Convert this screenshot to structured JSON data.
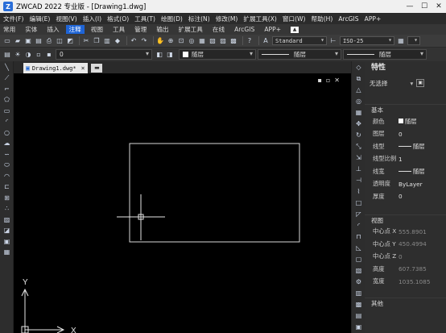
{
  "titlebar": {
    "app_icon": "Z",
    "title": "ZWCAD 2022 专业版 - [Drawing1.dwg]",
    "minimize": "—",
    "maximize": "☐",
    "close": "✕"
  },
  "menu": [
    "文件(F)",
    "编辑(E)",
    "视图(V)",
    "插入(I)",
    "格式(O)",
    "工具(T)",
    "绘图(D)",
    "标注(N)",
    "修改(M)",
    "扩展工具(X)",
    "窗口(W)",
    "帮助(H)",
    "ArcGIS",
    "APP+"
  ],
  "ribbon_tabs": [
    "常用",
    "实体",
    "插入",
    "注释",
    "视图",
    "工具",
    "管理",
    "输出",
    "扩展工具",
    "在线",
    "ArcGIS",
    "APP+"
  ],
  "ribbon_active": "注释",
  "toolbar": {
    "text_style": "Standard",
    "dim_style": "ISO-25",
    "layer_value": "0",
    "color_value": "随层",
    "linetype_value": "随层",
    "lineweight_value": "随层"
  },
  "document": {
    "tab_label": "Drawing1.dwg*",
    "close": "×"
  },
  "canvas": {
    "controls": [
      "▪",
      "▫",
      "✕"
    ],
    "ucs_x": "X",
    "ucs_y": "Y"
  },
  "properties": {
    "title": "特性",
    "selection": "无选择",
    "basic_section": "基本",
    "basic": [
      {
        "label": "颜色",
        "value": "随层",
        "kind": "swatch"
      },
      {
        "label": "图层",
        "value": "0",
        "kind": "text"
      },
      {
        "label": "线型",
        "value": "随层",
        "kind": "line"
      },
      {
        "label": "线型比例",
        "value": "1",
        "kind": "text"
      },
      {
        "label": "线宽",
        "value": "随层",
        "kind": "line"
      },
      {
        "label": "透明度",
        "value": "ByLayer",
        "kind": "text"
      },
      {
        "label": "厚度",
        "value": "0",
        "kind": "text"
      }
    ],
    "view_section": "视图",
    "view": [
      {
        "label": "中心点 X",
        "value": "555.8901"
      },
      {
        "label": "中心点 Y",
        "value": "450.4994"
      },
      {
        "label": "中心点 Z",
        "value": "0"
      },
      {
        "label": "高度",
        "value": "607.7385"
      },
      {
        "label": "宽度",
        "value": "1035.1085"
      }
    ],
    "misc_section": "其他"
  }
}
